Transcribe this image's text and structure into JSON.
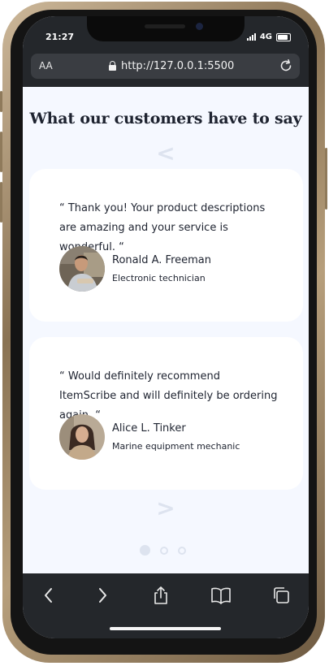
{
  "status": {
    "time": "21:27",
    "network": "4G"
  },
  "browser": {
    "text_size_label": "AA",
    "url": "http://127.0.0.1:5500"
  },
  "section": {
    "title": "What our customers have to say",
    "prev_arrow": "<",
    "next_arrow": ">"
  },
  "testimonials": [
    {
      "quote": "“ Thank you! Your product descriptions are amazing and your service is wonderful. “",
      "name": "Ronald A. Freeman",
      "role": "Electronic technician"
    },
    {
      "quote": "“ Would definitely recommend ItemScribe and will definitely be ordering again. “",
      "name": "Alice L. Tinker",
      "role": "Marine equipment mechanic"
    }
  ],
  "pagination": {
    "pages": 3,
    "active": 1
  },
  "colors": {
    "accent_light": "#dde3ef",
    "text_dark": "#1e2330",
    "page_bg": "#f5f8ff",
    "browser_chrome": "#24272b"
  },
  "icons": [
    "lock-icon",
    "reload-icon",
    "back-icon",
    "forward-icon",
    "share-icon",
    "bookmarks-icon",
    "tabs-icon"
  ]
}
